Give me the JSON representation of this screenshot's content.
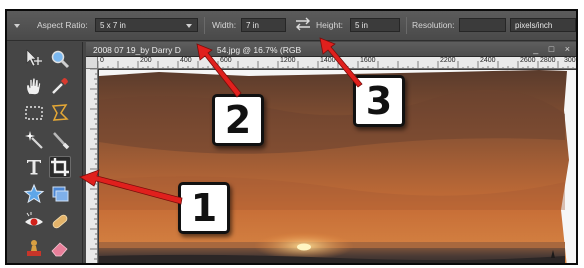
{
  "options_bar": {
    "aspect_ratio_label": "Aspect Ratio:",
    "aspect_ratio_value": "5 x 7 in",
    "width_label": "Width:",
    "width_value": "7 in",
    "height_label": "Height:",
    "height_value": "5 in",
    "resolution_label": "Resolution:",
    "resolution_value": "",
    "resolution_unit": "pixels/inch"
  },
  "toolbox": {
    "tools": [
      {
        "name": "move-tool-icon",
        "active": false
      },
      {
        "name": "zoom-tool-icon",
        "active": false
      },
      {
        "name": "hand-tool-icon",
        "active": false
      },
      {
        "name": "eyedropper-tool-icon",
        "active": false
      },
      {
        "name": "rectangular-marquee-icon",
        "active": false
      },
      {
        "name": "lasso-tool-icon",
        "active": false
      },
      {
        "name": "magic-wand-icon",
        "active": false
      },
      {
        "name": "selection-brush-icon",
        "active": false
      },
      {
        "name": "type-tool-icon",
        "active": false
      },
      {
        "name": "crop-tool-icon",
        "active": true
      },
      {
        "name": "cookie-cutter-icon",
        "active": false
      },
      {
        "name": "straighten-tool-icon",
        "active": false
      },
      {
        "name": "red-eye-tool-icon",
        "active": false
      },
      {
        "name": "healing-brush-icon",
        "active": false
      },
      {
        "name": "clone-stamp-icon",
        "active": false
      },
      {
        "name": "eraser-tool-icon",
        "active": false
      }
    ]
  },
  "document": {
    "title": "2008 07 19_by Darry D",
    "title_tail": "54.jpg @ 16.7% (RGB",
    "window_controls": "_ □ ×"
  },
  "ruler": {
    "h_ticks": [
      "0",
      "200",
      "400",
      "600",
      "1200",
      "1400",
      "1600",
      "2200",
      "2400",
      "2600",
      "2800",
      "300"
    ],
    "v_ticks": [
      "0",
      "200",
      "400",
      "600",
      "800",
      "1000",
      "1200",
      "1400",
      "1600",
      "1800"
    ]
  },
  "callouts": [
    {
      "number": "1"
    },
    {
      "number": "2"
    },
    {
      "number": "3"
    }
  ],
  "colors": {
    "arrow": "#e0201d",
    "panel": "#474747",
    "sunset_sky_top": "#c96e3a",
    "sun": "#fff6c2"
  }
}
